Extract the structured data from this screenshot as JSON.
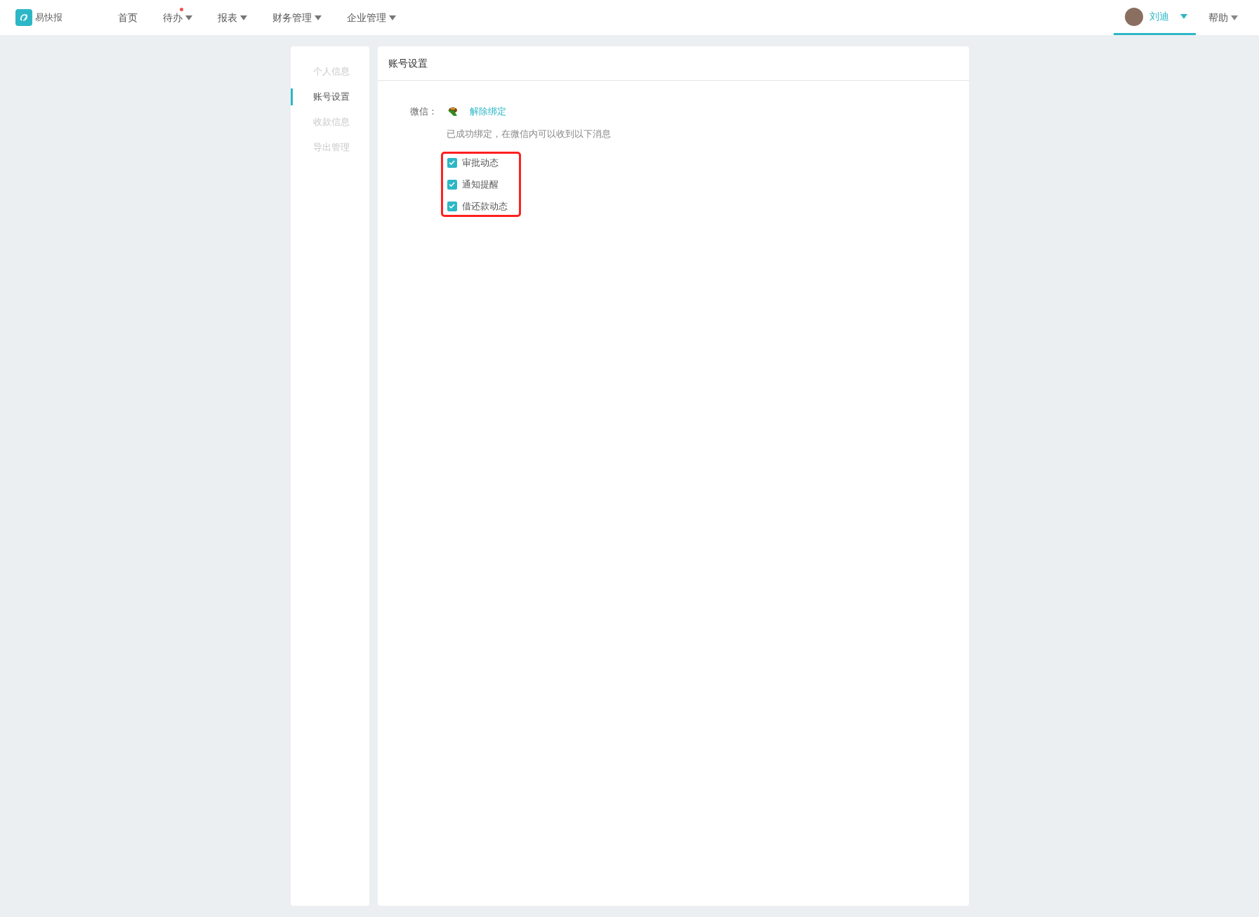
{
  "logo": {
    "text": "易快报"
  },
  "nav": [
    {
      "label": "首页",
      "has_menu": false,
      "badge": false
    },
    {
      "label": "待办",
      "has_menu": true,
      "badge": true
    },
    {
      "label": "报表",
      "has_menu": true,
      "badge": false
    },
    {
      "label": "财务管理",
      "has_menu": true,
      "badge": false
    },
    {
      "label": "企业管理",
      "has_menu": true,
      "badge": false
    }
  ],
  "user": {
    "name": "刘迪",
    "selected": true
  },
  "help": {
    "label": "帮助"
  },
  "sidebar": {
    "items": [
      {
        "label": "个人信息",
        "selected": false
      },
      {
        "label": "账号设置",
        "selected": true
      },
      {
        "label": "收款信息",
        "selected": false
      },
      {
        "label": "导出管理",
        "selected": false
      }
    ]
  },
  "panel": {
    "title": "账号设置",
    "wechat_label": "微信：",
    "unbind_link": "解除绑定",
    "note": "已成功绑定，在微信内可以收到以下消息",
    "options": [
      {
        "label": "审批动态",
        "checked": true
      },
      {
        "label": "通知提醒",
        "checked": true
      },
      {
        "label": "借还款动态",
        "checked": true
      }
    ]
  }
}
